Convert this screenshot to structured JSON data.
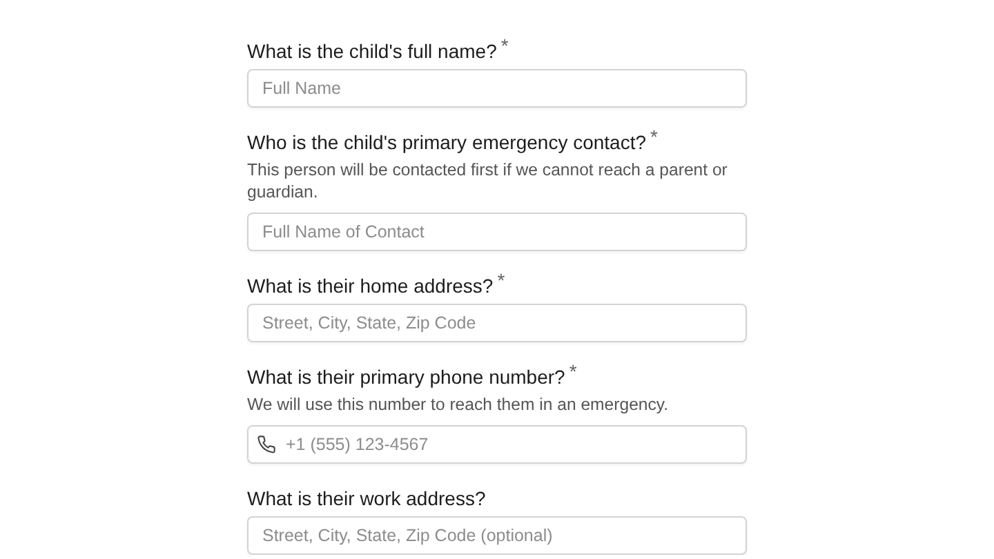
{
  "questions": [
    {
      "label": "What is the child's full name?",
      "required_mark": "*",
      "field": {
        "kind": "text",
        "placeholder": "Full Name"
      }
    },
    {
      "label": "Who is the child's primary emergency contact?",
      "required_mark": "*",
      "help": "This person will be contacted first if we cannot reach a parent or guardian.",
      "field": {
        "kind": "text",
        "placeholder": "Full Name of Contact"
      }
    },
    {
      "label": "What is their home address?",
      "required_mark": "*",
      "field": {
        "kind": "text",
        "placeholder": "Street, City, State, Zip Code"
      }
    },
    {
      "label": "What is their primary phone number?",
      "required_mark": "*",
      "help": "We will use this number to reach them in an emergency.",
      "field": {
        "kind": "phone",
        "placeholder": "+1 (555) 123-4567"
      }
    },
    {
      "label": "What is their work address?",
      "field": {
        "kind": "text",
        "placeholder": "Street, City, State, Zip Code (optional)"
      }
    }
  ]
}
